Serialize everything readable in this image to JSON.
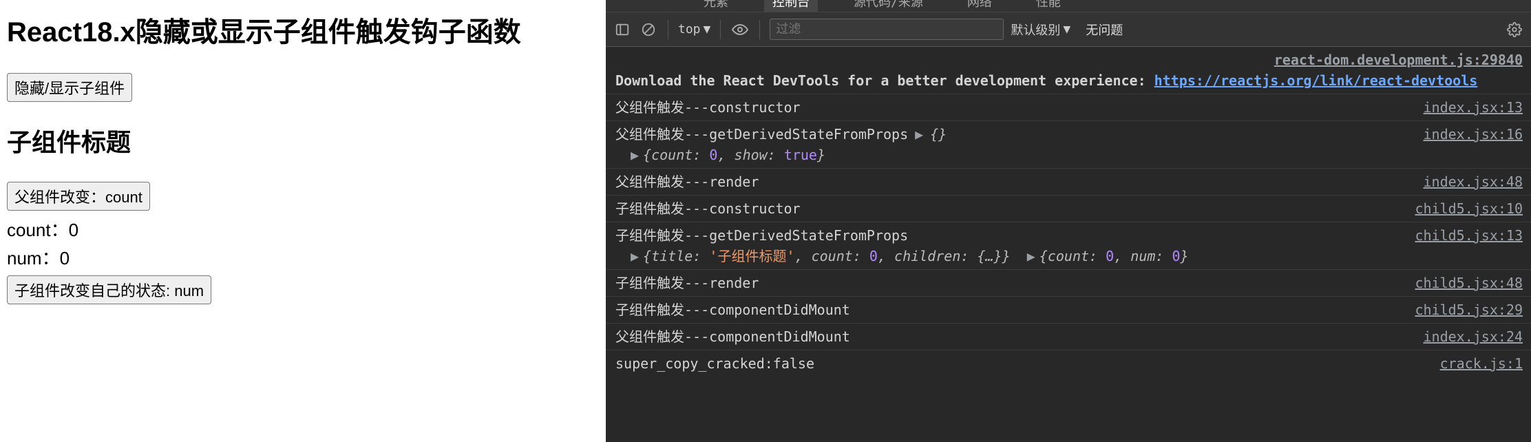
{
  "page": {
    "title": "React18.x隐藏或显示子组件触发钩子函数",
    "toggle_button": "隐藏/显示子组件",
    "child_title": "子组件标题",
    "parent_change_button": "父组件改变：count",
    "count_label": "count：0",
    "num_label": "num：0",
    "child_change_button": "子组件改变自己的状态: num"
  },
  "devtools": {
    "tabs": [
      "元素",
      "控制台",
      "源代码/来源",
      "网络",
      "性能"
    ],
    "active_tab": "控制台",
    "toolbar": {
      "context": "top",
      "filter_placeholder": "过滤",
      "levels": "默认级别",
      "no_issues": "无问题"
    },
    "messages": [
      {
        "id": 0,
        "type": "hint",
        "src": "react-dom.development.js:29840",
        "html": "Download the React DevTools for a better development experience: <span class='link' data-interactable='true'>https://reactjs.org/link/react-devtools</span>"
      },
      {
        "id": 1,
        "text": "父组件触发---constructor",
        "src": "index.jsx:13"
      },
      {
        "id": 2,
        "html": "父组件触发---getDerivedStateFromProps<span class='inline-group'><span class='caret' data-name='expand-caret-icon' data-interactable='true'>▶</span><span class='obj'>{}</span></span>",
        "sub_html": "<span class='caret' data-name='expand-caret-icon' data-interactable='true'>▶</span><span class='obj'>{<span class='key'>count</span>: <span class='num'>0</span>, <span class='key'>show</span>: <span class='bool'>true</span>}</span>",
        "src": "index.jsx:16"
      },
      {
        "id": 3,
        "text": "父组件触发---render",
        "src": "index.jsx:48"
      },
      {
        "id": 4,
        "text": "子组件触发---constructor",
        "src": "child5.jsx:10"
      },
      {
        "id": 5,
        "text": "子组件触发---getDerivedStateFromProps",
        "sub_html": "<span class='caret' data-name='expand-caret-icon' data-interactable='true'>▶</span><span class='obj'>{<span class='key'>title</span>: <span class='str'>'子组件标题'</span>, <span class='key'>count</span>: <span class='num'>0</span>, <span class='key'>children</span>: <span>{…}</span>}</span>&nbsp;&nbsp;<span class='caret' data-name='expand-caret-icon' data-interactable='true'>▶</span><span class='obj'>{<span class='key'>count</span>: <span class='num'>0</span>, <span class='key'>num</span>: <span class='num'>0</span>}</span>",
        "src": "child5.jsx:13"
      },
      {
        "id": 6,
        "text": "子组件触发---render",
        "src": "child5.jsx:48"
      },
      {
        "id": 7,
        "text": "子组件触发---componentDidMount",
        "src": "child5.jsx:29"
      },
      {
        "id": 8,
        "text": "父组件触发---componentDidMount",
        "src": "index.jsx:24"
      },
      {
        "id": 9,
        "text": "super_copy_cracked:false",
        "src": "crack.js:1"
      }
    ]
  }
}
